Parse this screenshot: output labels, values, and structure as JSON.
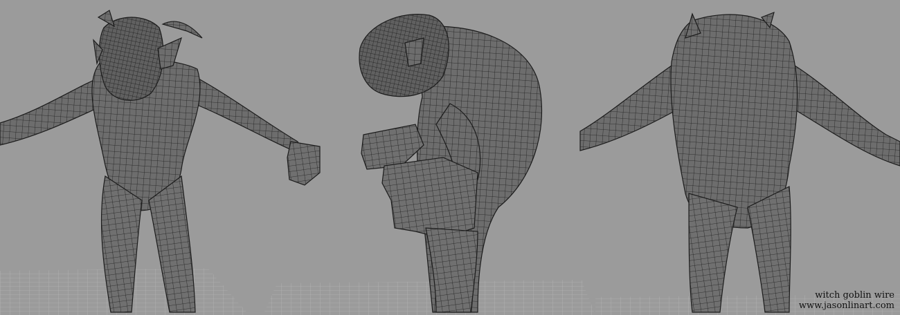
{
  "caption": {
    "title": "witch goblin wire",
    "site": "www.jasonlinart.com"
  },
  "views": [
    "front",
    "side",
    "back"
  ],
  "colors": {
    "background": "#9b9b9b",
    "mesh_fill": "#6e6e6e",
    "wire": "#1c1c1c",
    "grid": "#b4b4b4"
  }
}
